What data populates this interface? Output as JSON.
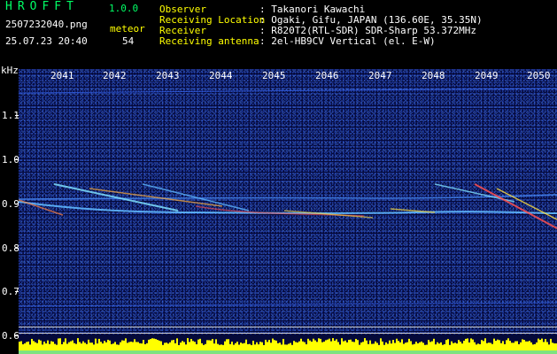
{
  "header": {
    "logo": "HROFFT",
    "version": "1.0.0",
    "filename": "2507232040.png",
    "datetime": "25.07.23 20:40",
    "count_label": "meteor",
    "count_value": "54",
    "info": [
      {
        "label": "Observer",
        "value": ": Takanori Kawachi"
      },
      {
        "label": "Receiving Location",
        "value": ": Ogaki, Gifu, JAPAN (136.60E, 35.35N)"
      },
      {
        "label": "Receiver",
        "value": ": R820T2(RTL-SDR) SDR-Sharp 53.372MHz"
      },
      {
        "label": "Receiving antenna",
        "value": ": 2el-HB9CV Vertical (el. E-W)"
      }
    ]
  },
  "plot": {
    "unit_label": "kHz",
    "x_ticks": [
      "2041",
      "2042",
      "2043",
      "2044",
      "2045",
      "2046",
      "2047",
      "2048",
      "2049",
      "2050"
    ],
    "y_ticks": [
      "1.1",
      "1.0",
      "0.9",
      "0.8",
      "0.7",
      "0.6"
    ],
    "colors": {
      "background": "#050a3a",
      "trace": "#5fb8ff",
      "echo": "#ff5050",
      "bar": "#ffff00",
      "bar_base": "#00c8ff"
    }
  }
}
